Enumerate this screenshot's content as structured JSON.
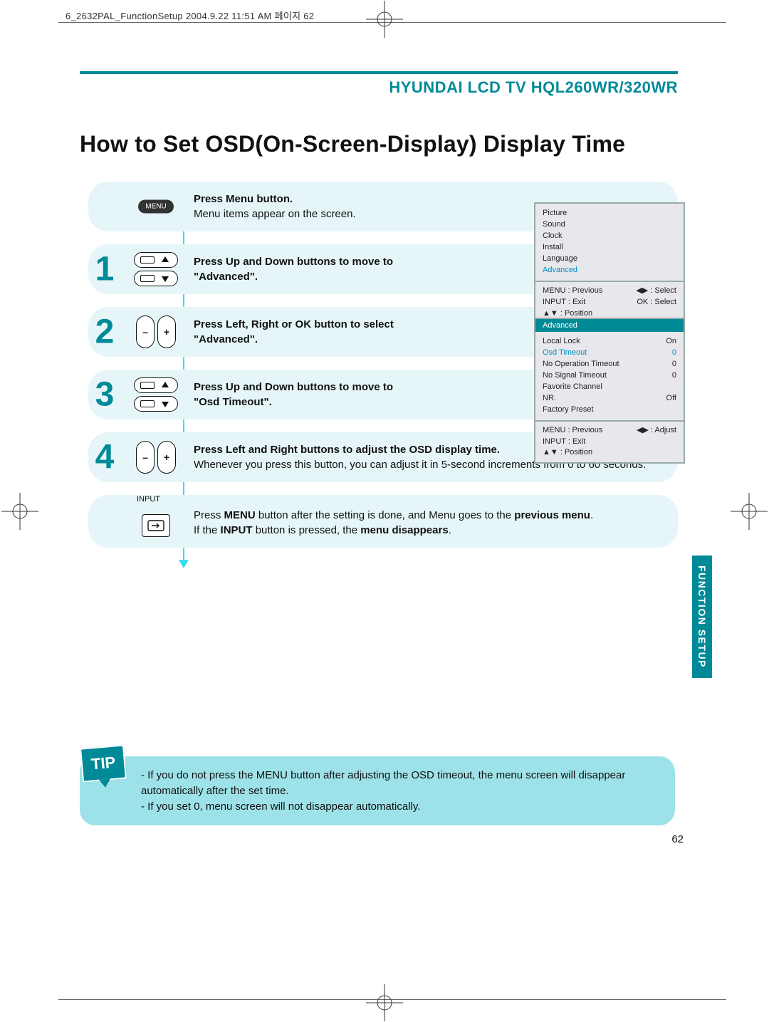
{
  "crop_meta": "6_2632PAL_FunctionSetup  2004.9.22 11:51 AM  페이지 62",
  "header": {
    "product_line": "HYUNDAI LCD TV HQL260WR/320WR"
  },
  "title": "How to Set OSD(On-Screen-Display) Display Time",
  "steps": {
    "menu": {
      "bold": "Press Menu button.",
      "rest": "Menu items appear on the screen."
    },
    "s1": {
      "num": "1",
      "bold": "Press Up and Down buttons to move to",
      "bold2": "\"Advanced\"."
    },
    "s2": {
      "num": "2",
      "bold": "Press Left, Right or OK button to select",
      "bold2": "\"Advanced\"."
    },
    "s3": {
      "num": "3",
      "bold": "Press Up and Down buttons to move to",
      "bold2": "\"Osd Timeout\"."
    },
    "s4": {
      "num": "4",
      "bold": "Press Left and Right buttons to adjust the OSD display time.",
      "rest": "Whenever you press this button, you can adjust it in 5-second increments from 0 to 60 seconds."
    },
    "input": {
      "label": "INPUT",
      "a": "Press ",
      "b": "MENU",
      "c": " button after the setting is done, and Menu goes to the ",
      "d": "previous menu",
      "e": ".",
      "f": "If the ",
      "g": "INPUT",
      "h": " button is pressed, the ",
      "i": "menu disappears",
      "j": "."
    }
  },
  "osd1": {
    "items": [
      "Picture",
      "Sound",
      "Clock",
      "Install",
      "Language",
      "Advanced"
    ],
    "footer": {
      "l1a": "MENU : Previous",
      "l1b": "◀▶ : Select",
      "l2a": "INPUT : Exit",
      "l2b": "OK : Select",
      "l3a": "▲▼ : Position"
    }
  },
  "osd2": {
    "header": "Advanced",
    "rows": [
      {
        "k": "Local Lock",
        "v": "On",
        "sel": false
      },
      {
        "k": "Osd Timeout",
        "v": "0",
        "sel": true
      },
      {
        "k": "No Operation Timeout",
        "v": "0",
        "sel": false
      },
      {
        "k": "No Signal Timeout",
        "v": "0",
        "sel": false
      },
      {
        "k": "Favorite Channel",
        "v": "",
        "sel": false
      },
      {
        "k": "NR.",
        "v": "Off",
        "sel": false
      },
      {
        "k": "Factory Preset",
        "v": "",
        "sel": false
      }
    ],
    "footer": {
      "l1a": "MENU : Previous",
      "l1b": "◀▶ : Adjust",
      "l2a": "INPUT : Exit",
      "l3a": "▲▼ : Position"
    }
  },
  "side_tab": "FUNCTION SETUP",
  "tip": {
    "badge": "TIP",
    "l1": "- If you do not press the MENU button after adjusting the OSD timeout, the menu screen will disappear",
    "l2": "  automatically after the set time.",
    "l3": "- If you set 0, menu screen will not disappear automatically."
  },
  "page_number": "62"
}
